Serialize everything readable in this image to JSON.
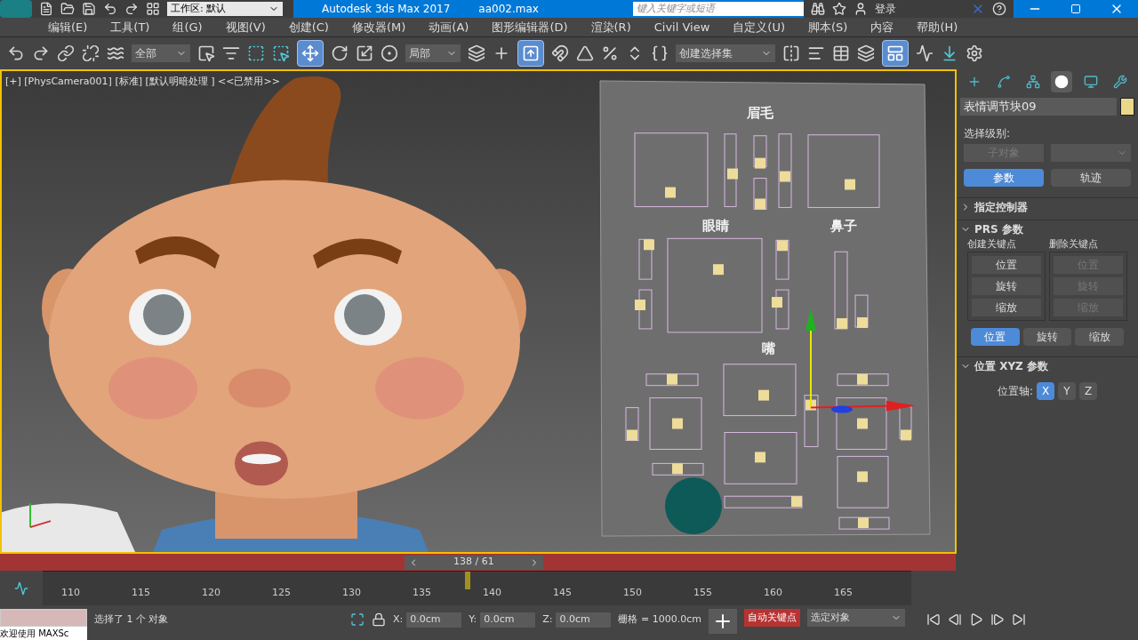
{
  "title_bar": {
    "workspace": "工作区: 默认",
    "app_title": "Autodesk 3ds Max 2017",
    "file_name": "aa002.max",
    "search_placeholder": "键入关键字或短语",
    "login": "登录"
  },
  "menu": [
    "编辑(E)",
    "工具(T)",
    "组(G)",
    "视图(V)",
    "创建(C)",
    "修改器(M)",
    "动画(A)",
    "图形编辑器(D)",
    "渲染(R)",
    "Civil View",
    "自定义(U)",
    "脚本(S)",
    "内容",
    "帮助(H)"
  ],
  "toolbar": {
    "selection_filter": "全部",
    "coord_system": "局部",
    "named_selection": "创建选择集",
    "move_tool": {
      "selected": true
    },
    "snap_toggle": {
      "selected": true
    },
    "layout_tool": {
      "selected": true
    }
  },
  "viewport": {
    "label": "[+] [PhysCamera001] [标准] [默认明暗处理 ] <<已禁用>>",
    "panel_labels": [
      "眉毛",
      "眼睛",
      "鼻子",
      "嘴"
    ]
  },
  "command_panel": {
    "tabs": [
      {
        "kind": "create",
        "selected": false
      },
      {
        "kind": "modify",
        "selected": false
      },
      {
        "kind": "hierarchy",
        "selected": false
      },
      {
        "kind": "motion",
        "selected": true
      },
      {
        "kind": "display",
        "selected": false
      },
      {
        "kind": "utilities",
        "selected": false
      }
    ],
    "object_name": "表情调节块09",
    "selection_level": "选择级别:",
    "sub_object": {
      "label": "子对象",
      "disabled": true
    },
    "modes": [
      {
        "label": "参数",
        "selected": true
      },
      {
        "label": "轨迹",
        "selected": false
      }
    ],
    "rollouts": [
      {
        "kind": "controller",
        "title": "指定控制器",
        "expanded": false
      },
      {
        "kind": "prs",
        "title": "PRS 参数",
        "expanded": true,
        "groups": [
          {
            "title": "创建关键点",
            "buttons": [
              {
                "label": "位置",
                "disabled": false
              },
              {
                "label": "旋转",
                "disabled": false
              },
              {
                "label": "缩放",
                "disabled": false
              }
            ]
          },
          {
            "title": "删除关键点",
            "buttons": [
              {
                "label": "位置",
                "disabled": true
              },
              {
                "label": "旋转",
                "disabled": true
              },
              {
                "label": "缩放",
                "disabled": true
              }
            ]
          }
        ],
        "modes": [
          {
            "label": "位置",
            "selected": true
          },
          {
            "label": "旋转",
            "selected": false
          },
          {
            "label": "缩放",
            "selected": false
          }
        ]
      },
      {
        "kind": "xyz",
        "title": "位置 XYZ 参数",
        "expanded": true,
        "axis_label": "位置轴:",
        "axes": [
          {
            "label": "X",
            "selected": true
          },
          {
            "label": "Y",
            "selected": false
          },
          {
            "label": "Z",
            "selected": false
          }
        ]
      }
    ]
  },
  "time_slider": {
    "frame": "138 / 61",
    "level": 0.495
  },
  "timeline": {
    "ticks": [
      "110",
      "115",
      "120",
      "125",
      "130",
      "135",
      "140",
      "145",
      "150",
      "155",
      "160",
      "165"
    ],
    "level": 0.49
  },
  "status": {
    "maxscript": "欢迎使用 MAXSc",
    "prompt": "选择了 1 个 对象",
    "coords": [
      {
        "axis": "X:",
        "value": "0.0cm"
      },
      {
        "axis": "Y:",
        "value": "0.0cm"
      },
      {
        "axis": "Z:",
        "value": "0.0cm"
      }
    ],
    "grid": "栅格 = 1000.0cm",
    "auto_key": {
      "label": "自动关键点",
      "on": true
    },
    "key_mode": "选定对象"
  }
}
